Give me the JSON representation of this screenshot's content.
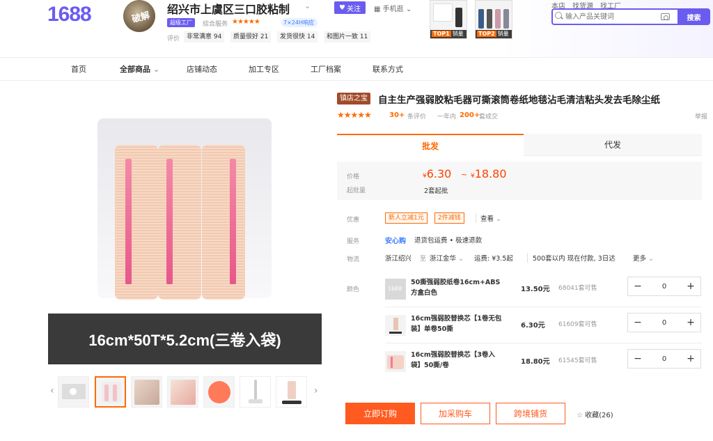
{
  "header": {
    "logo": "1688",
    "avatar_text": "破解",
    "shop_name": "绍兴市上虞区三口胶粘制",
    "follow_label": "关注",
    "mobile_label": "手机逛",
    "factory_badge": "超级工厂",
    "service_label": "综合服务",
    "service_stars": "★★★★★",
    "badge_24h": "7×24H响应",
    "eval_label": "评价",
    "eval_tags": [
      "非常满意 94",
      "质量很好 21",
      "发货很快 14",
      "和图片一致 11"
    ],
    "top_products": [
      {
        "rank": "TOP1",
        "tail": "销量"
      },
      {
        "rank": "TOP2",
        "tail": "销量"
      }
    ],
    "search_tabs": [
      "本店",
      "找货源",
      "找工厂"
    ],
    "search_placeholder": "输入产品关键词",
    "search_button": "搜索"
  },
  "nav": [
    "首页",
    "全部商品",
    "店铺动态",
    "加工专区",
    "工厂档案",
    "联系方式"
  ],
  "gallery": {
    "caption": "16cm*50T*5.2cm(三卷入袋)",
    "prev": "‹",
    "next": "›"
  },
  "product": {
    "title_badge": "镇店之宝",
    "title": "自主生产强弱胶粘毛器可撕滚筒卷纸地毯沾毛清洁粘头发去毛除尘纸",
    "stars": "★★★★★",
    "reviews_count": "30+",
    "reviews_label": "条评价",
    "sold_label": "一年内",
    "sold_count": "200+",
    "sold_tail": "套成交",
    "report": "举报"
  },
  "tabs": {
    "wholesale": "批发",
    "dropship": "代发"
  },
  "price": {
    "label": "价格",
    "currency": "¥",
    "low": "6.30",
    "tilde": "~",
    "high": "18.80",
    "moq_label": "起批量",
    "moq": "2套起批"
  },
  "promo": {
    "label": "优惠",
    "coupons": [
      "新人立减1元",
      "2件减钱"
    ],
    "view": "查看"
  },
  "service": {
    "label": "服务",
    "anxin": "安心购",
    "items": "退货包运费 • 极速退款"
  },
  "logistics": {
    "label": "物流",
    "from": "浙江绍兴",
    "to_label": "至",
    "to": "浙江金华",
    "fee": "运费: ¥3.5起",
    "delivery": "500套以内 现在付款, 3日达",
    "more": "更多"
  },
  "sku": {
    "label": "颜色",
    "items": [
      {
        "name": "50撕强弱胶纸卷16cm+ABS方盒白色",
        "price": "13.50元",
        "stock": "68041套可售",
        "qty": "0"
      },
      {
        "name": "16cm强弱胶替换芯【1卷无包装】单卷50撕",
        "price": "6.30元",
        "stock": "61609套可售",
        "qty": "0"
      },
      {
        "name": "16cm强弱胶替换芯【3卷入袋】50撕/卷",
        "price": "18.80元",
        "stock": "61545套可售",
        "qty": "0"
      }
    ],
    "minus": "−",
    "plus": "+"
  },
  "actions": {
    "order": "立即订购",
    "cart": "加采购车",
    "cross": "跨境铺货",
    "fav": "收藏(26)"
  },
  "colors": {
    "brand": "#6b5cf0",
    "accent": "#ff5a1f",
    "price": "#ff4000"
  }
}
